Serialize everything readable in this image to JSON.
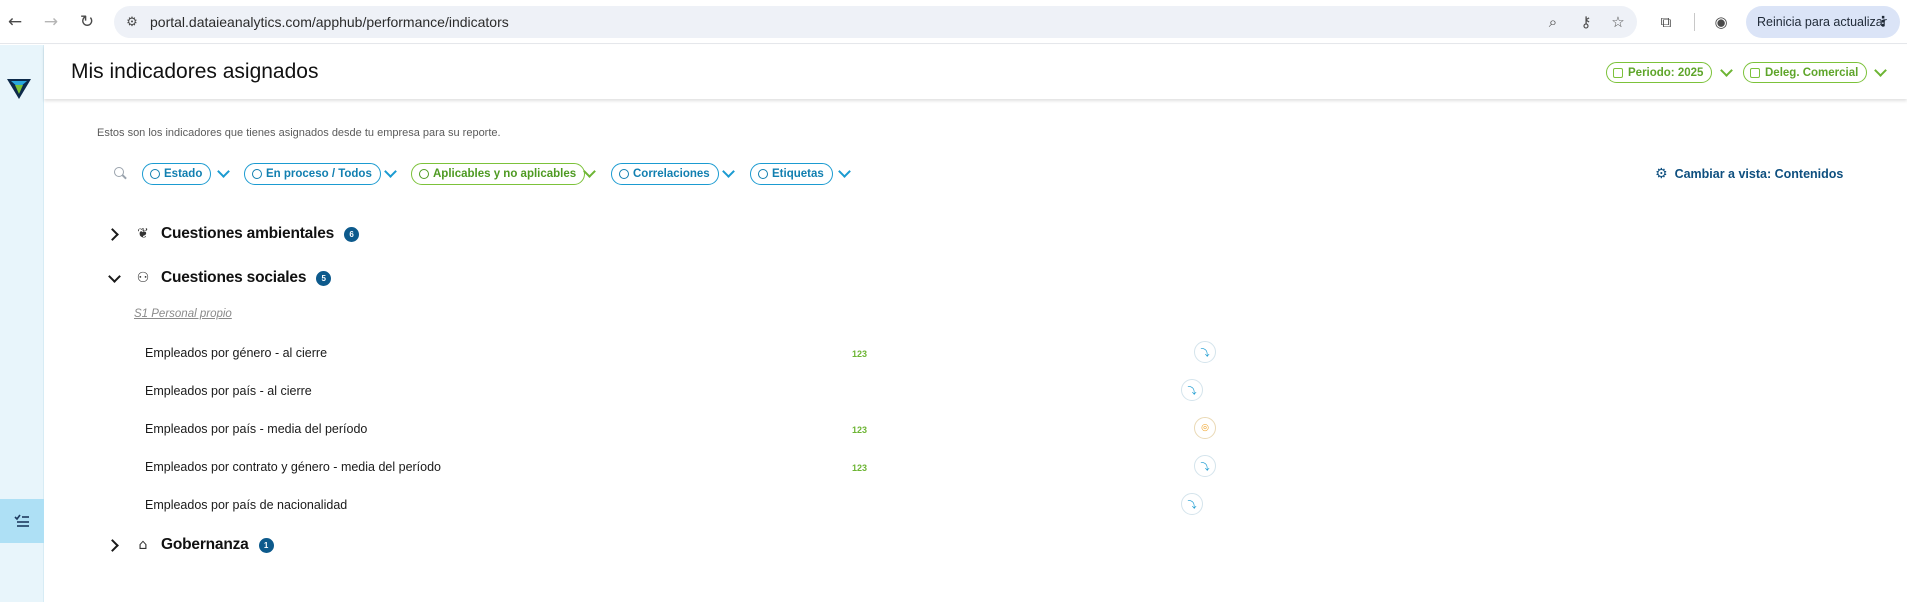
{
  "browser": {
    "url": "portal.dataieanalytics.com/apphub/performance/indicators",
    "update_label": "Reinicia para actualizar"
  },
  "header": {
    "title": "Mis indicadores asignados",
    "period_label": "Periodo: 2025",
    "delegation_label": "Deleg. Comercial"
  },
  "subtitle": "Estos son los indicadores que tienes asignados desde tu empresa para su reporte.",
  "filters": [
    {
      "label": "Estado",
      "style": "blue"
    },
    {
      "label": "En proceso / Todos",
      "style": "blue"
    },
    {
      "label": "Aplicables y no aplicables",
      "style": "green"
    },
    {
      "label": "Correlaciones",
      "style": "blue"
    },
    {
      "label": "Etiquetas",
      "style": "blue"
    }
  ],
  "view_switch": "Cambiar a vista: Contenidos",
  "sections": {
    "environmental": {
      "title": "Cuestiones ambientales",
      "count": "6",
      "icon": "leaf-icon",
      "expanded": false
    },
    "social": {
      "title": "Cuestiones sociales",
      "count": "5",
      "icon": "people-icon",
      "expanded": true
    },
    "governance": {
      "title": "Gobernanza",
      "count": "1",
      "icon": "bank-icon",
      "expanded": false
    }
  },
  "group_label": "S1 Personal propio",
  "indicators": [
    {
      "name": "Empleados por género - al cierre",
      "tag": "123",
      "status": "pending"
    },
    {
      "name": "Empleados por país - al cierre",
      "tag": "",
      "status": "pending"
    },
    {
      "name": "Empleados por país - media del período",
      "tag": "123",
      "status": "warning"
    },
    {
      "name": "Empleados por contrato y género - media del período",
      "tag": "123",
      "status": "pending"
    },
    {
      "name": "Empleados por país de nacionalidad",
      "tag": "",
      "status": "pending"
    }
  ],
  "colors": {
    "accent_blue": "#1b9bd1",
    "accent_green": "#7cc23a",
    "badge_navy": "#0d5a8c",
    "rail_bg": "#e8f5fb"
  }
}
